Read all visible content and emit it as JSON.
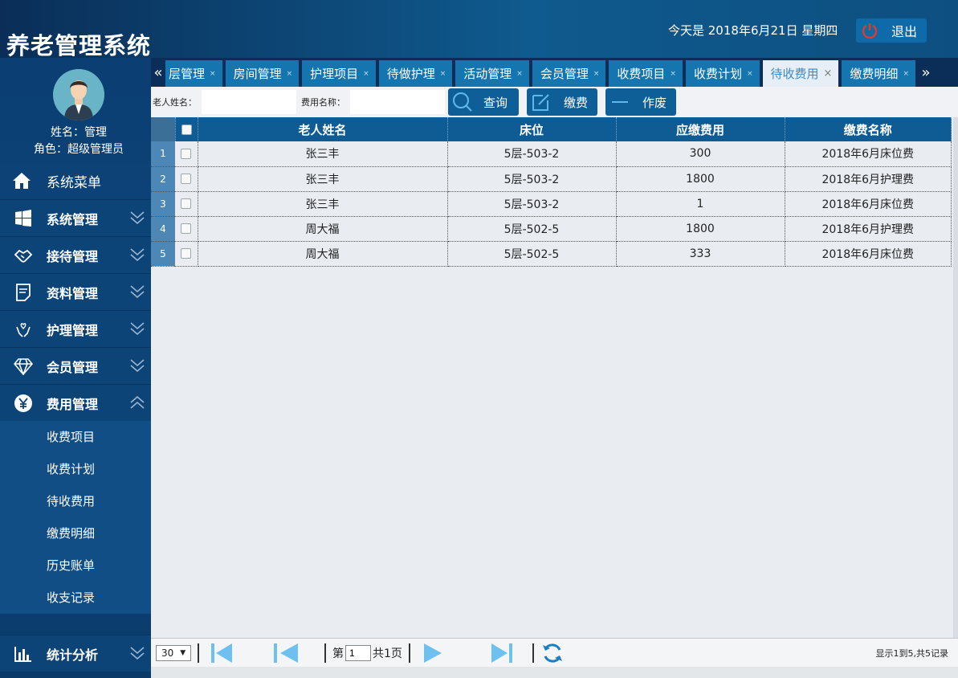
{
  "app": {
    "title": "养老管理系统",
    "date_text": "今天是 2018年6月21日 星期四",
    "logout_label": "退出"
  },
  "profile": {
    "name": "姓名：管理",
    "role": "角色：超级管理员"
  },
  "sidebar": {
    "header": "系统菜单",
    "items": [
      {
        "label": "系统管理",
        "icon": "windows-icon"
      },
      {
        "label": "接待管理",
        "icon": "handshake-icon"
      },
      {
        "label": "资料管理",
        "icon": "document-icon"
      },
      {
        "label": "护理管理",
        "icon": "care-hands-icon"
      },
      {
        "label": "会员管理",
        "icon": "diamond-icon"
      },
      {
        "label": "费用管理",
        "icon": "yen-icon"
      }
    ],
    "sub_items": [
      "收费项目",
      "收费计划",
      "待收费用",
      "缴费明细",
      "历史账单",
      "收支记录"
    ],
    "bottom_item": {
      "label": "统计分析",
      "icon": "bar-chart-icon"
    }
  },
  "tabs": {
    "left_arrow": "«",
    "right_arrow": "»",
    "items": [
      {
        "label": "楼层管理"
      },
      {
        "label": "房间管理"
      },
      {
        "label": "护理项目"
      },
      {
        "label": "待做护理"
      },
      {
        "label": "活动管理"
      },
      {
        "label": "会员管理"
      },
      {
        "label": "收费项目"
      },
      {
        "label": "收费计划"
      },
      {
        "label": "待收费用",
        "active": true
      },
      {
        "label": "缴费明细"
      }
    ],
    "first_visible_text": "层管理"
  },
  "search": {
    "elder_name_label": "老人姓名：",
    "elder_name_value": "",
    "fee_name_label": "费用名称：",
    "fee_name_value": "",
    "query_label": "查询",
    "pay_label": "缴费",
    "void_label": "作废"
  },
  "grid": {
    "columns": [
      "老人姓名",
      "床位",
      "应缴费用",
      "缴费名称"
    ],
    "rows": [
      {
        "num": "1",
        "name": "张三丰",
        "bed": "5层-503-2",
        "amount": "300",
        "fee_name": "2018年6月床位费"
      },
      {
        "num": "2",
        "name": "张三丰",
        "bed": "5层-503-2",
        "amount": "1800",
        "fee_name": "2018年6月护理费"
      },
      {
        "num": "3",
        "name": "张三丰",
        "bed": "5层-503-2",
        "amount": "1",
        "fee_name": "2018年6月床位费"
      },
      {
        "num": "4",
        "name": "周大福",
        "bed": "5层-502-5",
        "amount": "1800",
        "fee_name": "2018年6月护理费"
      },
      {
        "num": "5",
        "name": "周大福",
        "bed": "5层-502-5",
        "amount": "333",
        "fee_name": "2018年6月床位费"
      }
    ]
  },
  "pager": {
    "page_size": "30",
    "page_prefix": "第",
    "page_value": "1",
    "page_suffix": "共1页",
    "info": "显示1到5,共5记录"
  },
  "colors": {
    "accent": "#0f5b93",
    "header_bg": "#0a2e57",
    "active_tab_text": "#3a8ac8",
    "logout_icon": "#e03a2e"
  }
}
